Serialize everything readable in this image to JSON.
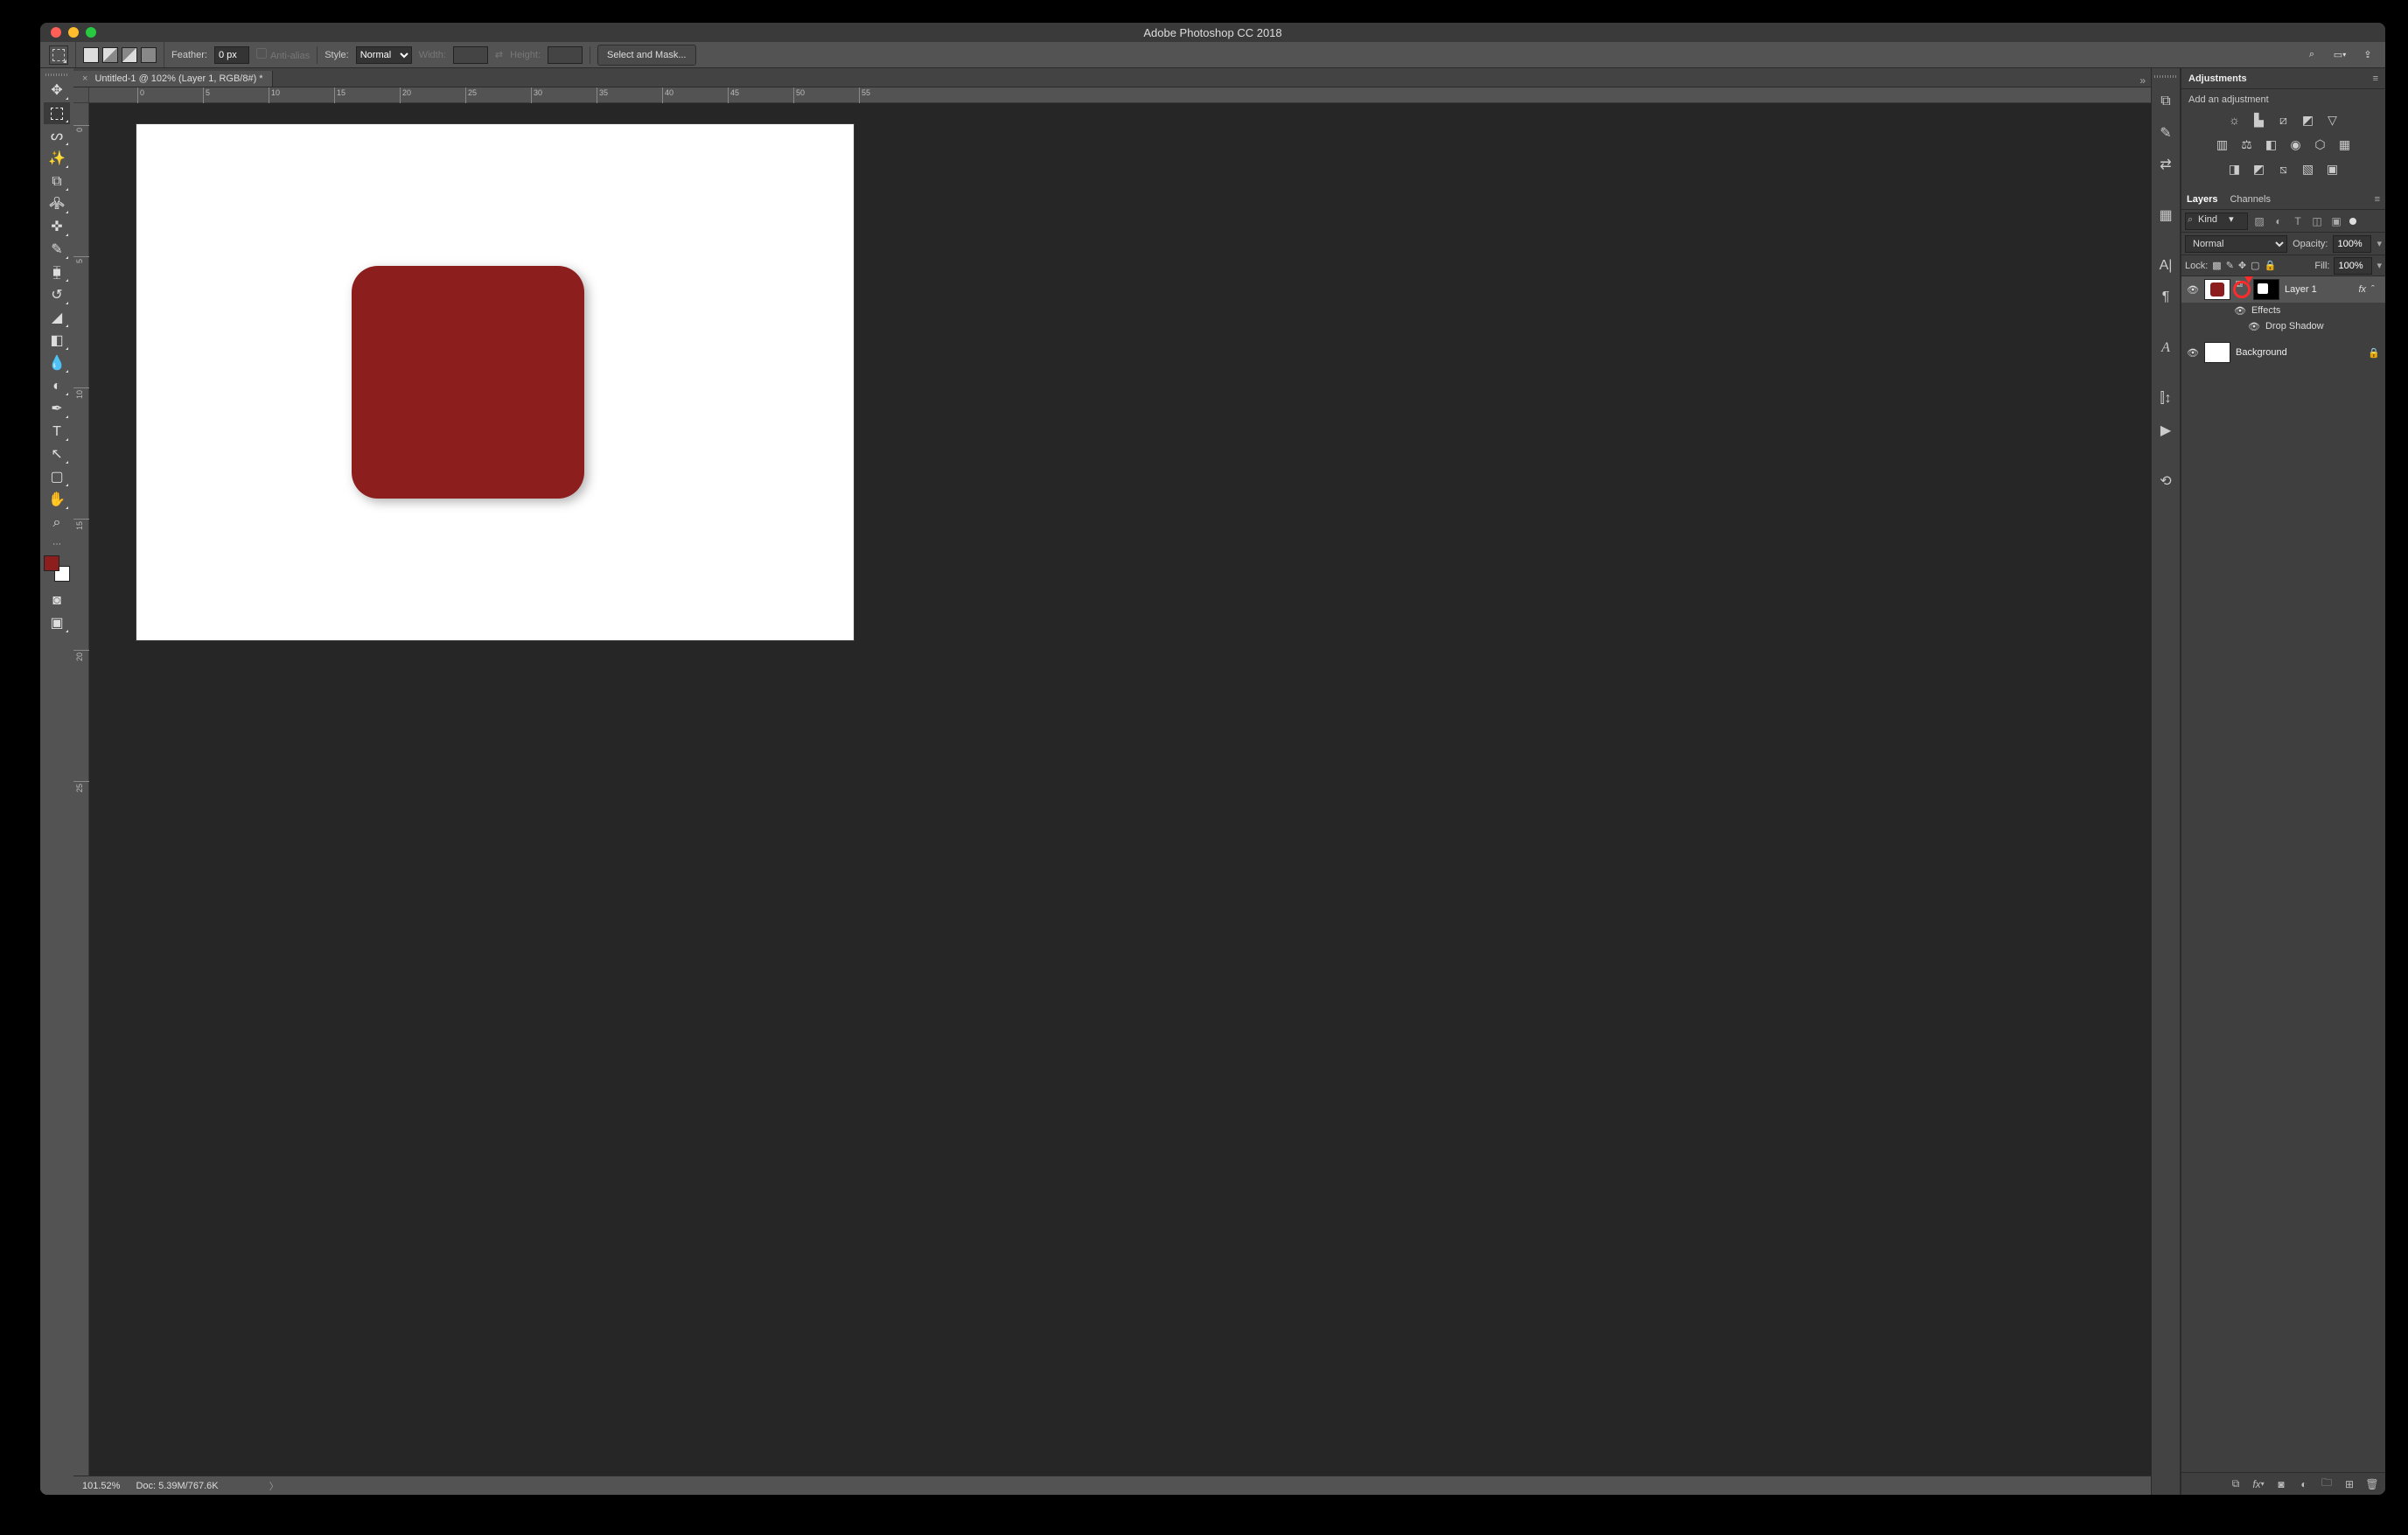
{
  "titlebar": {
    "title": "Adobe Photoshop CC 2018"
  },
  "optionsbar": {
    "feather_label": "Feather:",
    "feather_value": "0 px",
    "antialias_label": "Anti-alias",
    "style_label": "Style:",
    "style_value": "Normal",
    "width_label": "Width:",
    "height_label": "Height:",
    "selectmask": "Select and Mask..."
  },
  "doc": {
    "tab_title": "Untitled-1 @ 102% (Layer 1, RGB/8#) *",
    "zoom": "101.52%",
    "docinfo": "Doc: 5.39M/767.6K"
  },
  "ruler_h": [
    "0",
    "5",
    "10",
    "15",
    "20",
    "25",
    "30",
    "35",
    "40",
    "45",
    "50",
    "55"
  ],
  "ruler_v": [
    "0",
    "5",
    "10",
    "15",
    "20",
    "25"
  ],
  "shape_color": "#8d1e1e",
  "swatch_fg": "#8d1e1e",
  "adjustments": {
    "panel_title": "Adjustments",
    "subtitle": "Add an adjustment"
  },
  "layers": {
    "tab_layers": "Layers",
    "tab_channels": "Channels",
    "filter_kind": "Kind",
    "blend_mode": "Normal",
    "opacity_label": "Opacity:",
    "opacity_value": "100%",
    "lock_label": "Lock:",
    "fill_label": "Fill:",
    "fill_value": "100%",
    "layer1_name": "Layer 1",
    "layer1_fx": "fx",
    "effects": "Effects",
    "dropshadow": "Drop Shadow",
    "background": "Background"
  }
}
